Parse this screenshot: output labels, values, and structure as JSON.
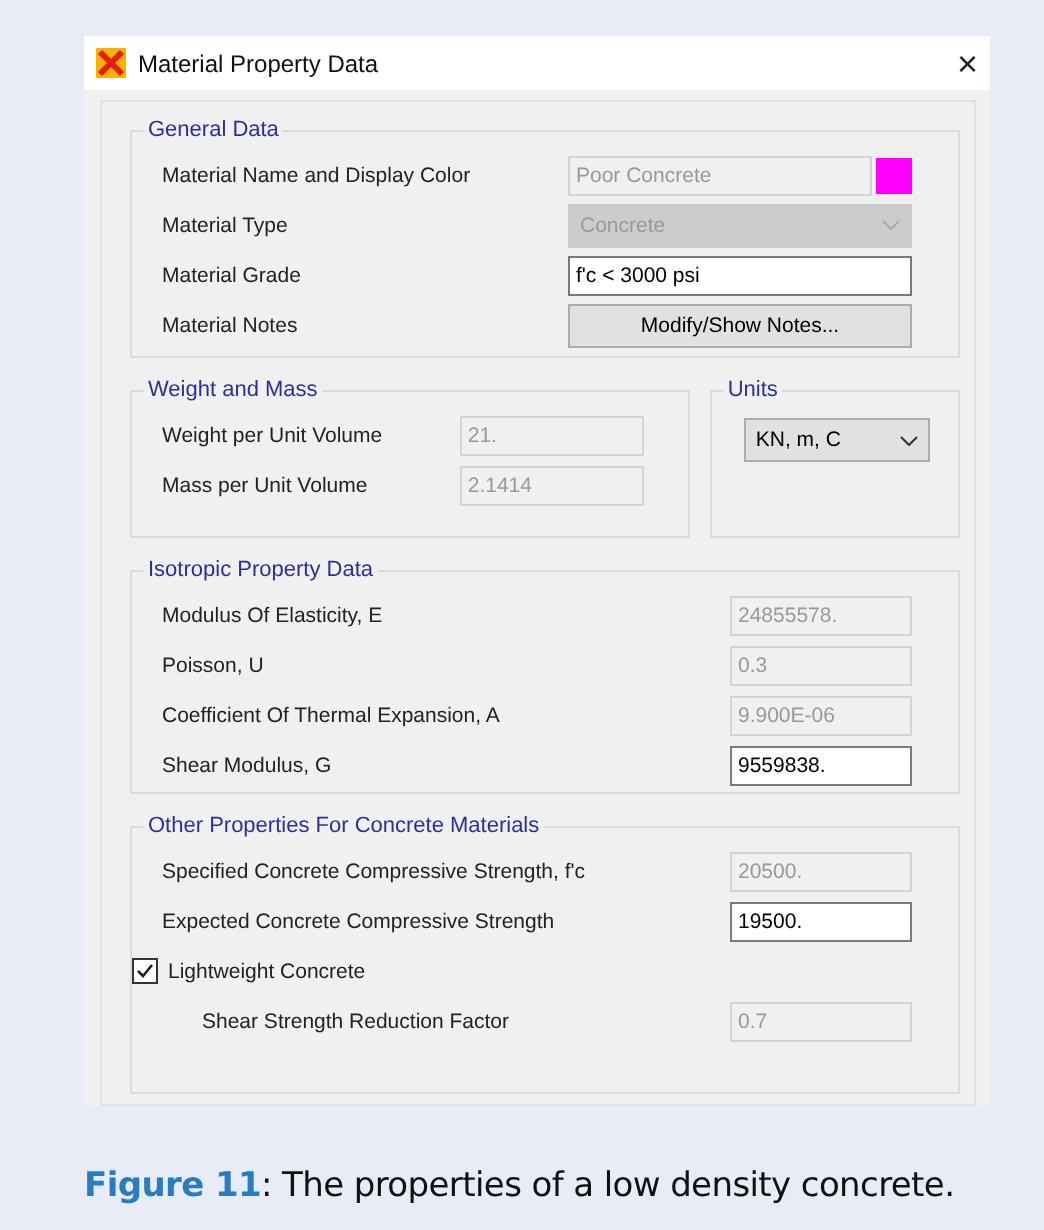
{
  "window": {
    "title": "Material Property Data",
    "close": "×"
  },
  "general": {
    "title": "General Data",
    "rows": [
      {
        "kind": "text",
        "label": "Material Name and Display Color",
        "value": "Poor Concrete",
        "disabled": true,
        "color": "#ff00ff"
      },
      {
        "kind": "select",
        "label": "Material Type",
        "value": "Concrete",
        "disabled": true
      },
      {
        "kind": "text",
        "label": "Material Grade",
        "value": "f'c < 3000 psi",
        "disabled": false
      },
      {
        "kind": "button",
        "label": "Material Notes",
        "button": "Modify/Show Notes..."
      }
    ]
  },
  "weight_and_mass": {
    "title": "Weight and Mass",
    "rows": [
      {
        "kind": "text",
        "label": "Weight per Unit Volume",
        "value": "21.",
        "disabled": true
      },
      {
        "kind": "text",
        "label": "Mass per Unit Volume",
        "value": "2.1414",
        "disabled": true
      }
    ]
  },
  "units": {
    "title": "Units",
    "value": "KN, m, C",
    "disabled": false
  },
  "isotropic": {
    "title": "Isotropic Property Data",
    "rows": [
      {
        "kind": "text",
        "label": "Modulus Of Elasticity,  E",
        "value": "24855578.",
        "disabled": true
      },
      {
        "kind": "text",
        "label": "Poisson,  U",
        "value": "0.3",
        "disabled": true
      },
      {
        "kind": "text",
        "label": "Coefficient Of Thermal Expansion,  A",
        "value": "9.900E-06",
        "disabled": true
      },
      {
        "kind": "text",
        "label": "Shear Modulus,  G",
        "value": "9559838.",
        "disabled": false
      }
    ]
  },
  "concrete": {
    "title": "Other Properties For Concrete Materials",
    "rows": [
      {
        "kind": "text",
        "label": "Specified Concrete Compressive Strength, f'c",
        "value": "20500.",
        "disabled": true
      },
      {
        "kind": "text",
        "label": "Expected Concrete Compressive Strength",
        "value": "19500.",
        "disabled": false
      },
      {
        "kind": "checkbox",
        "label": "Lightweight Concrete",
        "checked": true,
        "children": [
          {
            "kind": "text",
            "label": "Shear Strength Reduction Factor",
            "value": "0.7",
            "disabled": true
          }
        ]
      }
    ]
  },
  "caption": "**Figure 11**: The properties of a low density concrete."
}
